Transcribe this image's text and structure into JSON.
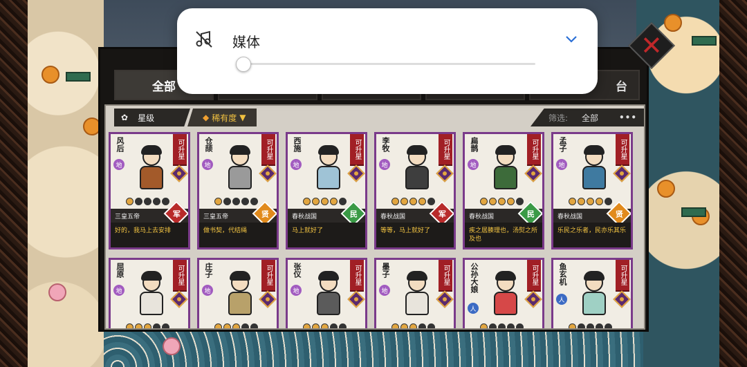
{
  "volume_popup": {
    "label": "媒体",
    "level": 0,
    "mute_icon": "music-off-icon",
    "expand_icon": "chevron-down-icon"
  },
  "tabs": [
    {
      "label": "全部",
      "active": true
    },
    {
      "label": ""
    },
    {
      "label": ""
    },
    {
      "label": ""
    },
    {
      "label": "台"
    }
  ],
  "filters": {
    "star_label": "星级",
    "rarity_label": "稀有度",
    "screen_label": "筛选:",
    "screen_value": "全部",
    "more": "•••"
  },
  "heroes": [
    {
      "name": "风后",
      "element": "地",
      "upgrade": "可升星",
      "stars": 1,
      "era": "三皇五帝",
      "type": "军",
      "type_color": "#b82a2a",
      "robe": "#a35a2a",
      "quote": "好的，我马上去安排"
    },
    {
      "name": "仓颉",
      "element": "地",
      "upgrade": "可升星",
      "stars": 1,
      "era": "三皇五帝",
      "type": "贤",
      "type_color": "#e18a1c",
      "robe": "#9a9a9a",
      "quote": "做书契，代结绳"
    },
    {
      "name": "西施",
      "element": "地",
      "upgrade": "可升星",
      "stars": 4,
      "era": "春秋战国",
      "type": "民",
      "type_color": "#3a9a46",
      "robe": "#9fc3d6",
      "quote": "马上就好了"
    },
    {
      "name": "李牧",
      "element": "地",
      "upgrade": "可升星",
      "stars": 4,
      "era": "春秋战国",
      "type": "军",
      "type_color": "#b82a2a",
      "robe": "#3e3e3e",
      "quote": "等等，马上就好了"
    },
    {
      "name": "扁鹊",
      "element": "地",
      "upgrade": "可升星",
      "stars": 4,
      "era": "春秋战国",
      "type": "民",
      "type_color": "#3a9a46",
      "robe": "#3d6b3a",
      "quote": "疾之居腠理也，汤熨之所及也"
    },
    {
      "name": "孟子",
      "element": "地",
      "upgrade": "可升星",
      "stars": 4,
      "era": "春秋战国",
      "type": "贤",
      "type_color": "#e18a1c",
      "robe": "#3f7aa0",
      "quote": "乐民之乐者，民亦乐其乐"
    },
    {
      "name": "屈原",
      "element": "地",
      "upgrade": "可升星",
      "stars": 3,
      "robe": "#e8e4dc"
    },
    {
      "name": "庄子",
      "element": "地",
      "upgrade": "可升星",
      "stars": 3,
      "robe": "#b8a16a"
    },
    {
      "name": "张仪",
      "element": "地",
      "upgrade": "可升星",
      "stars": 3,
      "robe": "#5b5b5b"
    },
    {
      "name": "墨子",
      "element": "地",
      "upgrade": "可升星",
      "stars": 3,
      "robe": "#e8e4dc"
    },
    {
      "name": "公孙大娘",
      "element": "人",
      "upgrade": "可升星",
      "stars": 1,
      "robe": "#d64848"
    },
    {
      "name": "鱼玄机",
      "element": "人",
      "upgrade": "可升星",
      "stars": 1,
      "robe": "#9fd0c4"
    }
  ]
}
